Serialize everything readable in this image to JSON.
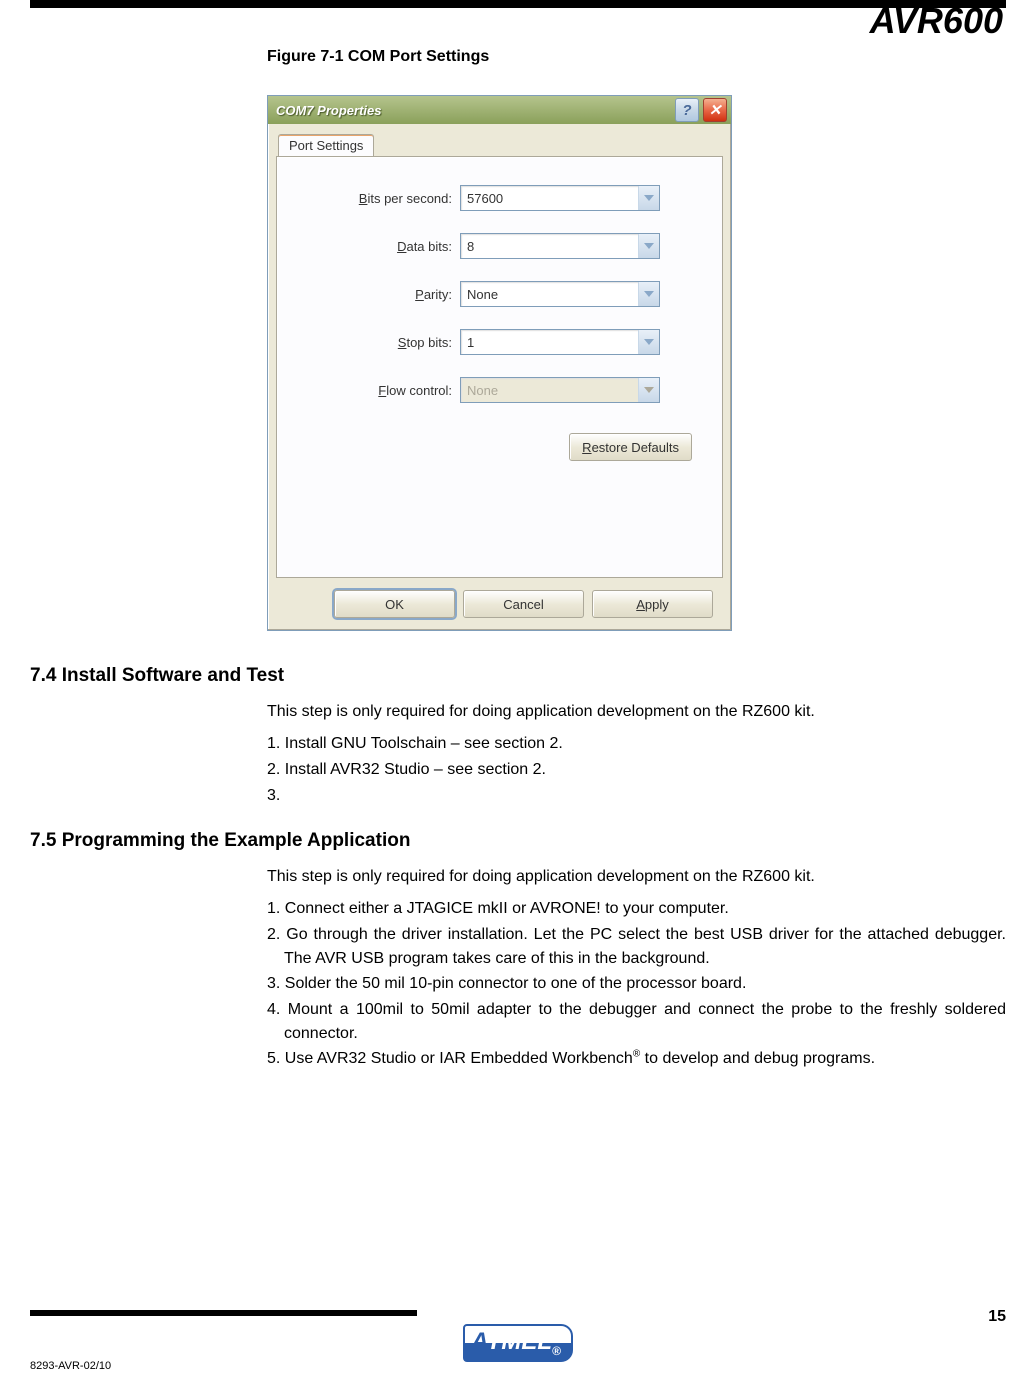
{
  "doc_title": "AVR600",
  "figure_caption": "Figure 7-1 COM Port Settings",
  "dialog": {
    "title": "COM7 Properties",
    "tab_label": "Port Settings",
    "fields": {
      "bits_per_second": {
        "label": "Bits per second:",
        "value": "57600"
      },
      "data_bits": {
        "label": "Data bits:",
        "value": "8"
      },
      "parity": {
        "label": "Parity:",
        "value": "None"
      },
      "stop_bits": {
        "label": "Stop bits:",
        "value": "1"
      },
      "flow_control": {
        "label": "Flow control:",
        "value": "None"
      }
    },
    "restore_btn": "Restore Defaults",
    "ok_btn": "OK",
    "cancel_btn": "Cancel",
    "apply_btn": "Apply"
  },
  "sections": {
    "s74": {
      "heading": "7.4 Install Software and Test",
      "intro": "This step is only required for doing application development on the RZ600 kit.",
      "item1": "1. Install GNU Toolschain – see section 2.",
      "item2": "2. Install AVR32 Studio – see section 2.",
      "item3": "3."
    },
    "s75": {
      "heading": "7.5 Programming the Example Application",
      "intro": "This step is only required for doing application development on the RZ600 kit.",
      "item1": "1. Connect either a JTAGICE mkII or AVRONE! to your computer.",
      "item2": "2. Go through the driver installation. Let the PC select the best USB driver for the attached debugger. The AVR USB program takes care of this in the background.",
      "item3": "3. Solder the 50 mil 10-pin connector to one of the processor board.",
      "item4": "4. Mount a 100mil to 50mil adapter to the debugger and connect the probe to the freshly soldered connector.",
      "item5a": "5. Use AVR32 Studio or IAR Embedded Workbench",
      "item5b": " to develop and debug programs."
    }
  },
  "footer": {
    "logo_text": "ATMEL",
    "page_num": "15",
    "doc_code": "8293-AVR-02/10"
  }
}
